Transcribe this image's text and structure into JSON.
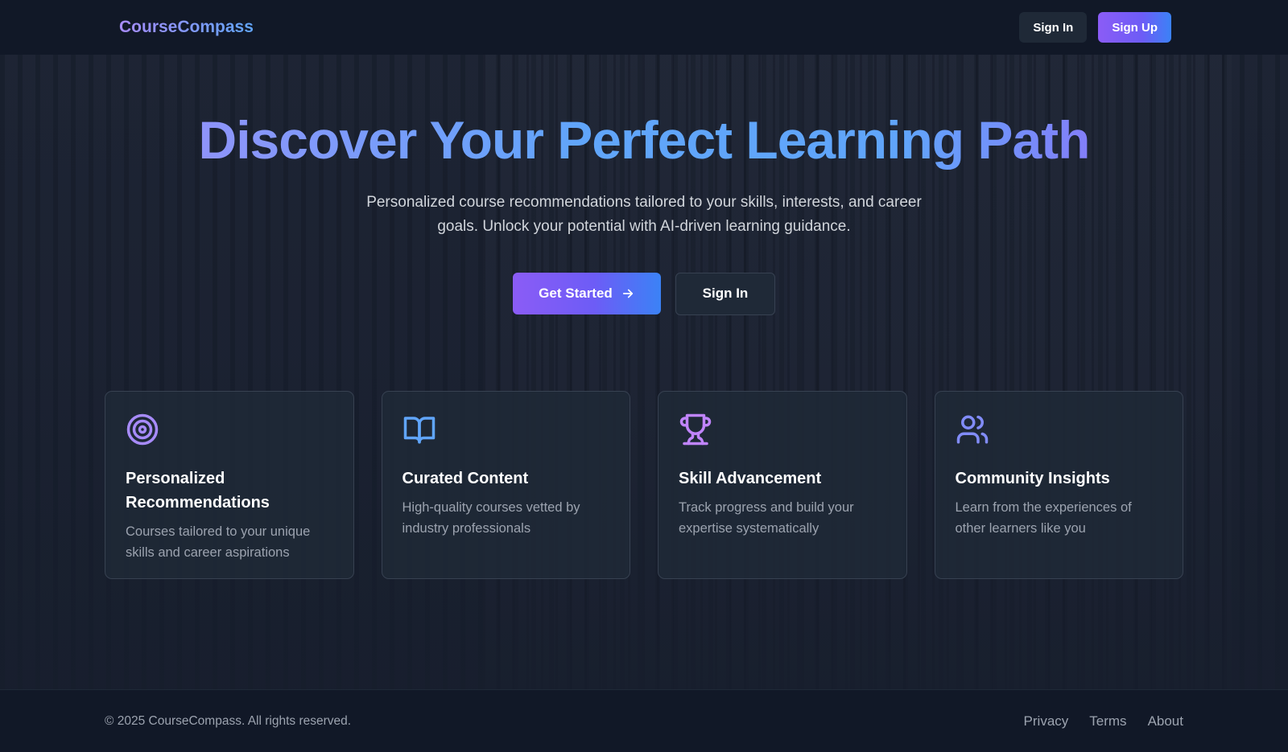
{
  "brand": {
    "name": "CourseCompass"
  },
  "header": {
    "sign_in_label": "Sign In",
    "sign_up_label": "Sign Up"
  },
  "hero": {
    "title": "Discover Your Perfect Learning Path",
    "subtitle": "Personalized course recommendations tailored to your skills, interests, and career goals. Unlock your potential with AI-driven learning guidance.",
    "get_started_label": "Get Started",
    "sign_in_label": "Sign In"
  },
  "features": [
    {
      "icon": "target-icon",
      "title": "Personalized Recommendations",
      "description": "Courses tailored to your unique skills and career aspirations"
    },
    {
      "icon": "book-open-icon",
      "title": "Curated Content",
      "description": "High-quality courses vetted by industry professionals"
    },
    {
      "icon": "trophy-icon",
      "title": "Skill Advancement",
      "description": "Track progress and build your expertise systematically"
    },
    {
      "icon": "users-icon",
      "title": "Community Insights",
      "description": "Learn from the experiences of other learners like you"
    }
  ],
  "footer": {
    "copyright": "© 2025 CourseCompass. All rights reserved.",
    "links": [
      "Privacy",
      "Terms",
      "About"
    ]
  },
  "colors": {
    "accent_purple": "#8b5cf6",
    "accent_blue": "#3b82f6",
    "background": "#161d2d"
  }
}
